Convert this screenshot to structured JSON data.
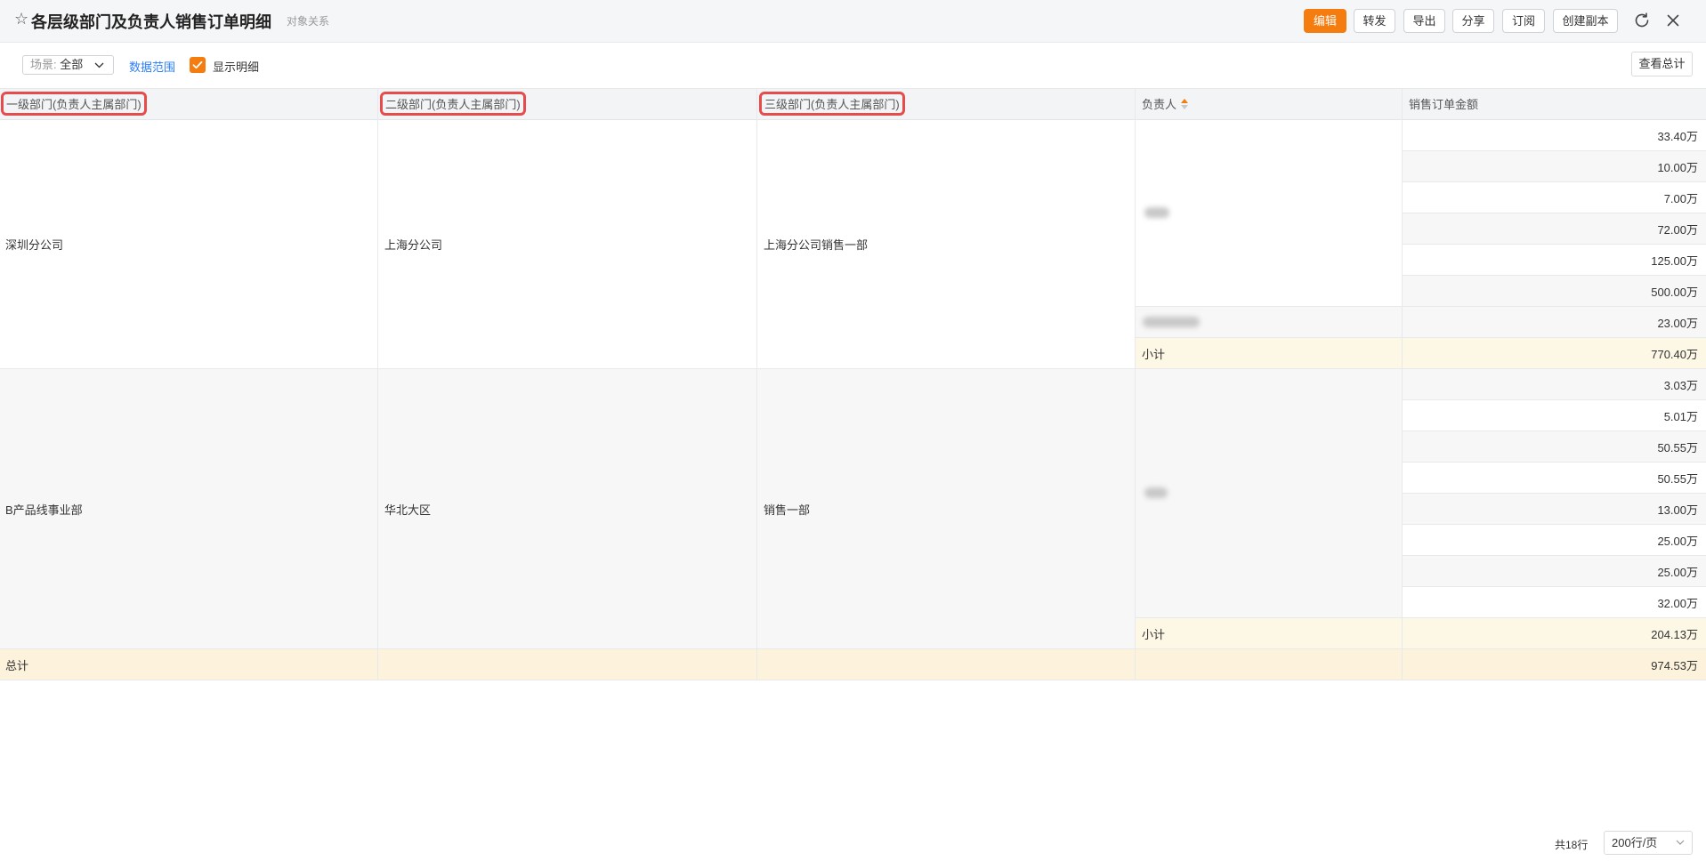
{
  "header": {
    "star": "☆",
    "title": "各层级部门及负责人销售订单明细",
    "subtitle": "对象关系",
    "buttons": {
      "edit": "编辑",
      "forward": "转发",
      "export": "导出",
      "share": "分享",
      "subscribe": "订阅",
      "copy": "创建副本"
    }
  },
  "toolbar": {
    "scene_label": "场景:",
    "scene_value": "全部",
    "data_range": "数据范围",
    "show_detail": "显示明细",
    "show_detail_checked": true,
    "view_total": "查看总计"
  },
  "table": {
    "headers": [
      "一级部门(负责人主属部门)",
      "二级部门(负责人主属部门)",
      "三级部门(负责人主属部门)",
      "负责人",
      "销售订单金额"
    ],
    "groups": [
      {
        "level1": "深圳分公司",
        "level2": "上海分公司",
        "level3": "上海分公司销售一部",
        "amounts": [
          "33.40万",
          "10.00万",
          "7.00万",
          "72.00万",
          "125.00万",
          "500.00万",
          "23.00万"
        ],
        "subtotal_label": "小计",
        "subtotal": "770.40万"
      },
      {
        "level1": "B产品线事业部",
        "level2": "华北大区",
        "level3": "销售一部",
        "amounts": [
          "3.03万",
          "5.01万",
          "50.55万",
          "50.55万",
          "13.00万",
          "25.00万",
          "25.00万",
          "32.00万"
        ],
        "subtotal_label": "小计",
        "subtotal": "204.13万"
      }
    ],
    "grand_total_label": "总计",
    "grand_total": "974.53万"
  },
  "footer": {
    "count": "共18行",
    "page_size": "200行/页"
  },
  "colors": {
    "accent": "#f57c0f",
    "link": "#2d7ff9",
    "highlight_box": "#e74c4c"
  }
}
